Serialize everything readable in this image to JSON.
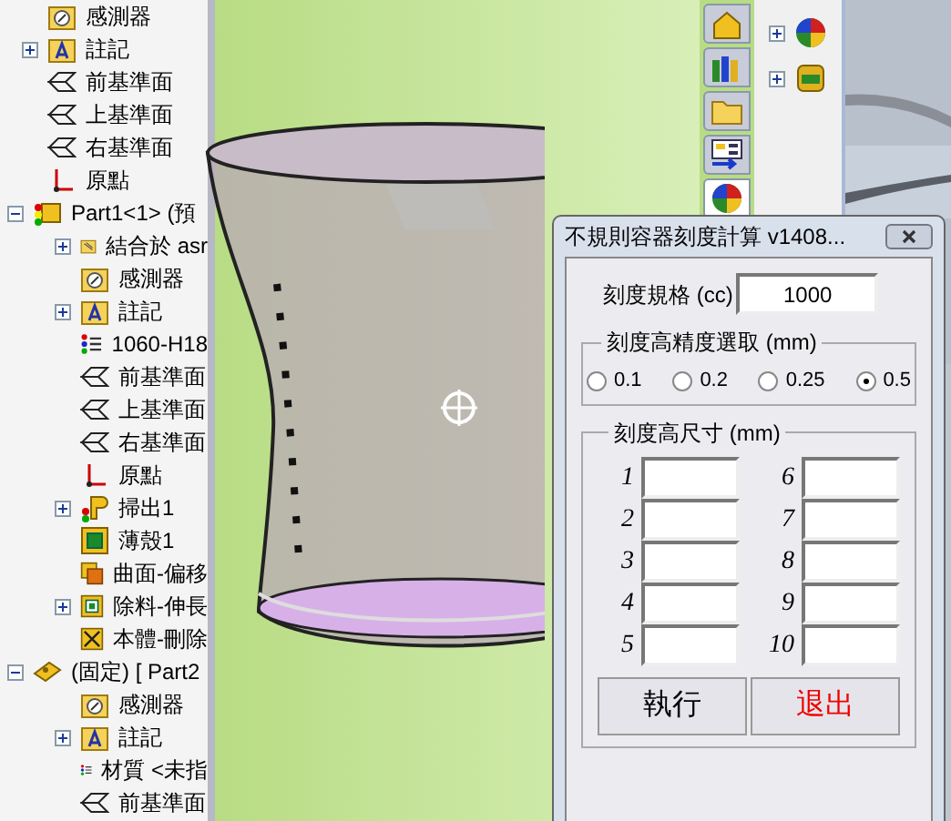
{
  "feature_tree": {
    "items": [
      {
        "label": "感測器",
        "kind": "sensor"
      },
      {
        "label": "註記",
        "kind": "annotation",
        "expanded": false
      },
      {
        "label": "前基準面",
        "kind": "plane"
      },
      {
        "label": "上基準面",
        "kind": "plane"
      },
      {
        "label": "右基準面",
        "kind": "plane"
      },
      {
        "label": "原點",
        "kind": "origin"
      },
      {
        "label": "Part1<1> (預",
        "kind": "part",
        "expanded": true,
        "children": [
          {
            "label": "結合於 asr",
            "kind": "mate",
            "expanded": false
          },
          {
            "label": "感測器",
            "kind": "sensor"
          },
          {
            "label": "註記",
            "kind": "annotation",
            "expanded": false
          },
          {
            "label": "1060-H18",
            "kind": "material"
          },
          {
            "label": "前基準面",
            "kind": "plane"
          },
          {
            "label": "上基準面",
            "kind": "plane"
          },
          {
            "label": "右基準面",
            "kind": "plane"
          },
          {
            "label": "原點",
            "kind": "origin"
          },
          {
            "label": "掃出1",
            "kind": "sweep",
            "expanded": false
          },
          {
            "label": "薄殼1",
            "kind": "shell"
          },
          {
            "label": "曲面-偏移",
            "kind": "surface"
          },
          {
            "label": "除料-伸長",
            "kind": "cut",
            "expanded": false
          },
          {
            "label": "本體-刪除",
            "kind": "delete"
          }
        ]
      },
      {
        "label": "(固定) [ Part2",
        "kind": "fixed",
        "expanded": true,
        "children": [
          {
            "label": "感測器",
            "kind": "sensor"
          },
          {
            "label": "註記",
            "kind": "annotation",
            "expanded": false
          },
          {
            "label": "材質 <未指",
            "kind": "material"
          },
          {
            "label": "前基準面",
            "kind": "plane"
          }
        ]
      }
    ]
  },
  "task_pane": {
    "tabs": [
      {
        "kind": "home",
        "selected": false
      },
      {
        "kind": "library",
        "selected": false
      },
      {
        "kind": "folder",
        "selected": false
      },
      {
        "kind": "properties",
        "selected": false
      },
      {
        "kind": "appearance",
        "selected": true
      }
    ],
    "items": [
      {
        "kind": "appearance",
        "expanded": false
      },
      {
        "kind": "scene",
        "expanded": false
      }
    ]
  },
  "dialog": {
    "title": "不規則容器刻度計算 v1408...",
    "spec_label": "刻度規格 (cc)",
    "spec_value": "1000",
    "precision": {
      "title": "刻度高精度選取 (mm)",
      "options": [
        {
          "label": "0.1",
          "selected": false
        },
        {
          "label": "0.2",
          "selected": false
        },
        {
          "label": "0.25",
          "selected": false
        },
        {
          "label": "0.5",
          "selected": true
        }
      ]
    },
    "sizes": {
      "title": "刻度高尺寸 (mm)",
      "fields": [
        {
          "label": "1"
        },
        {
          "label": "2"
        },
        {
          "label": "3"
        },
        {
          "label": "4"
        },
        {
          "label": "5"
        },
        {
          "label": "6"
        },
        {
          "label": "7"
        },
        {
          "label": "8"
        },
        {
          "label": "9"
        },
        {
          "label": "10"
        }
      ]
    },
    "buttons": [
      {
        "label": "執行",
        "kind": "run"
      },
      {
        "label": "退出",
        "kind": "exit"
      }
    ]
  }
}
